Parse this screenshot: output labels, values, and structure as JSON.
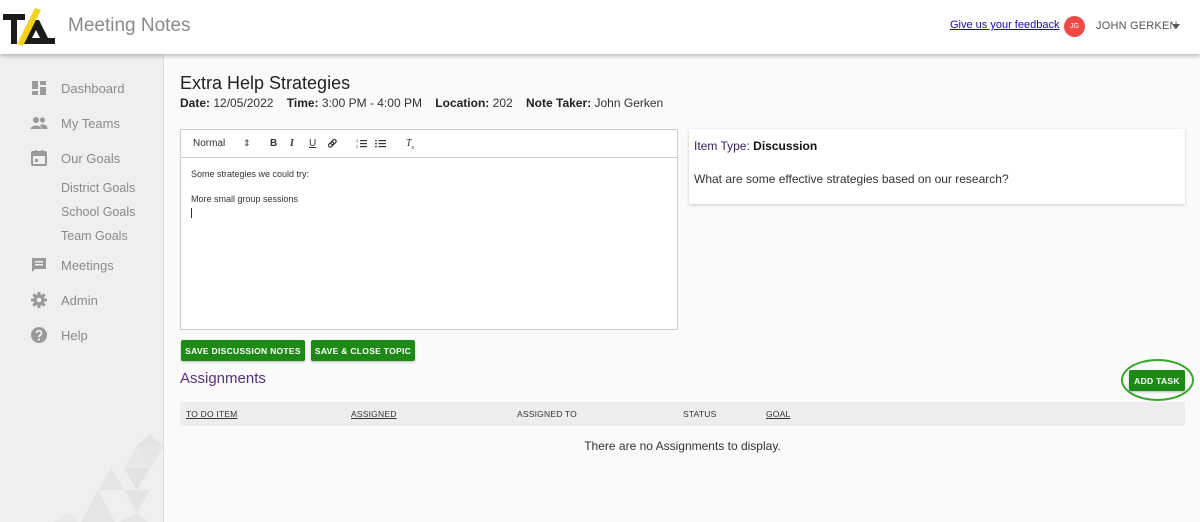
{
  "header": {
    "app_title": "Meeting Notes",
    "feedback_link": "Give us your feedback",
    "avatar_initials": "JG",
    "user_name": "JOHN GERKEN"
  },
  "sidebar": {
    "items": [
      {
        "label": "Dashboard",
        "icon": "dashboard-icon"
      },
      {
        "label": "My Teams",
        "icon": "people-icon"
      },
      {
        "label": "Our Goals",
        "icon": "calendar-icon"
      },
      {
        "label": "Meetings",
        "icon": "chat-icon"
      },
      {
        "label": "Admin",
        "icon": "gear-icon"
      },
      {
        "label": "Help",
        "icon": "help-icon"
      }
    ],
    "sub_items": [
      "District Goals",
      "School Goals",
      "Team Goals"
    ]
  },
  "topic": {
    "title": "Extra Help Strategies",
    "date_label": "Date:",
    "date": "12/05/2022",
    "time_label": "Time:",
    "time": "3:00 PM - 4:00 PM",
    "location_label": "Location:",
    "location": "202",
    "note_taker_label": "Note Taker:",
    "note_taker": "John Gerken"
  },
  "editor": {
    "format_select": "Normal",
    "lines": [
      "Some strategies we could try:",
      "More small group sessions"
    ]
  },
  "item": {
    "type_label": "Item Type:",
    "type": "Discussion",
    "question": "What are some effective strategies based on our research?"
  },
  "buttons": {
    "save_notes": "SAVE DISCUSSION NOTES",
    "save_close": "SAVE & CLOSE TOPIC",
    "add_task": "ADD TASK"
  },
  "assignments": {
    "title": "Assignments",
    "columns": [
      "TO DO ITEM",
      "ASSIGNED",
      "ASSIGNED TO",
      "STATUS",
      "GOAL"
    ],
    "empty_message": "There are no Assignments to display."
  },
  "colors": {
    "accent_green": "#1d8a16",
    "section_purple": "#5a2f82",
    "avatar_red": "#ef4a45"
  }
}
